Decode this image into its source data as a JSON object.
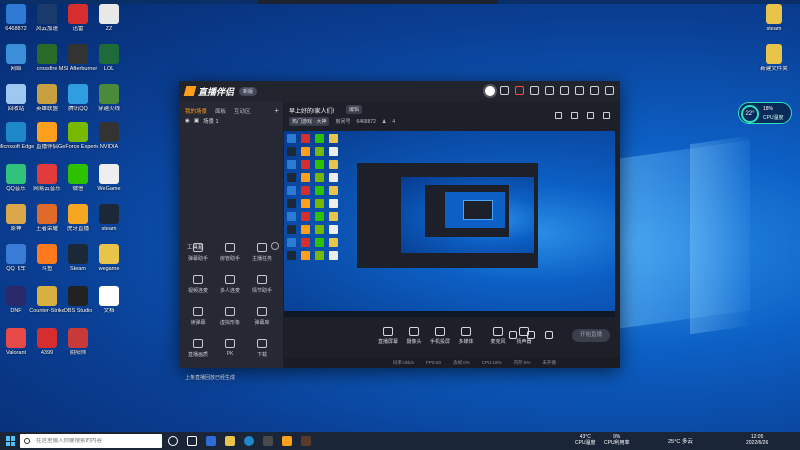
{
  "desktop": {
    "left_icons": [
      {
        "label": "6468872",
        "color": "#2e7bd6"
      },
      {
        "label": "风云加速",
        "color": "#1a3a6b"
      },
      {
        "label": "迅雷",
        "color": "#d62e2e"
      },
      {
        "label": "ZZ",
        "color": "#e8e8e8"
      },
      {
        "label": "网络",
        "color": "#3a8fd8"
      },
      {
        "label": "crossfire",
        "color": "#2a6b2a"
      },
      {
        "label": "MSI Afterburner",
        "color": "#333"
      },
      {
        "label": "LOL",
        "color": "#1e6b3a"
      },
      {
        "label": "回收站",
        "color": "#9ec8f0"
      },
      {
        "label": "英雄联盟",
        "color": "#c8a040"
      },
      {
        "label": "腾讯QQ",
        "color": "#2e9ee0"
      },
      {
        "label": "穿越火线",
        "color": "#4a8a3a"
      },
      {
        "label": "Microsoft Edge",
        "color": "#1e88c8"
      },
      {
        "label": "直播伴侣",
        "color": "#ff9f1c"
      },
      {
        "label": "GeForce Experience",
        "color": "#76b900"
      },
      {
        "label": "NVIDIA",
        "color": "#333"
      },
      {
        "label": "QQ音乐",
        "color": "#31c27c"
      },
      {
        "label": "网易云音乐",
        "color": "#e23b3b"
      },
      {
        "label": "微信",
        "color": "#2dc100"
      },
      {
        "label": "WeGame",
        "color": "#eee"
      },
      {
        "label": "原神",
        "color": "#d9a64a"
      },
      {
        "label": "王者荣耀",
        "color": "#e06a2a"
      },
      {
        "label": "虎牙直播",
        "color": "#f5a623"
      },
      {
        "label": "steam",
        "color": "#1b2838"
      },
      {
        "label": "QQ飞车",
        "color": "#3a7bd5"
      },
      {
        "label": "斗鱼",
        "color": "#ff7a1c"
      },
      {
        "label": "Steam",
        "color": "#1b2838"
      },
      {
        "label": "wegame",
        "color": "#e8c44a"
      },
      {
        "label": "DNF",
        "color": "#2a2a6b"
      },
      {
        "label": "Counter-Strike",
        "color": "#d8b040"
      },
      {
        "label": "OBS Studio",
        "color": "#222"
      },
      {
        "label": "文档",
        "color": "#ffffff"
      },
      {
        "label": "Valorant",
        "color": "#e84a4a"
      },
      {
        "label": "4399",
        "color": "#d62e2e"
      },
      {
        "label": "阴阳师",
        "color": "#c83a3a"
      }
    ],
    "right_icons": [
      {
        "label": "steam",
        "color": "#e8c44a"
      },
      {
        "label": "新建文件夹",
        "color": "#e8c44a"
      }
    ],
    "cpu_widget": {
      "temp": "22°",
      "usage": "18%",
      "label": "CPU温度"
    }
  },
  "app": {
    "title": "直播伴侣",
    "version_badge": "新版",
    "tabs": [
      "我的场景",
      "面板",
      "互动区"
    ],
    "scene_name": "场景 1",
    "room_title": "早上好的!家人们!",
    "edit_label": "编辑",
    "category": "热门游戏 · 大神",
    "room_id_label": "房间号",
    "room_id": "6468872",
    "fans_count": "4",
    "tools_header": "工具箱",
    "tools": [
      {
        "label": "弹幕助手"
      },
      {
        "label": "房管助手"
      },
      {
        "label": "主播任务"
      },
      {
        "label": "视频连麦"
      },
      {
        "label": "多人连麦"
      },
      {
        "label": "情节助手"
      },
      {
        "label": "读弹幕"
      },
      {
        "label": "虚拟形象"
      },
      {
        "label": "弹幕库"
      },
      {
        "label": "直播画质"
      },
      {
        "label": "PK"
      },
      {
        "label": "下载"
      }
    ],
    "notice": "上条直播回放已经生成",
    "controls": [
      {
        "label": "直播屏幕"
      },
      {
        "label": "摄像头"
      },
      {
        "label": "手机投屏"
      },
      {
        "label": "多媒体"
      },
      {
        "label": "麦克风"
      },
      {
        "label": "扬声器"
      }
    ],
    "start_button": "开始直播",
    "status": [
      "码率:0kb/s",
      "FPS:60",
      "丢帧:0%",
      "CPU:18%",
      "内存:5%",
      "未开播"
    ]
  },
  "taskbar": {
    "search_placeholder": "在这里输入你要搜索的内容",
    "cpu_temp": "43°C",
    "cpu_temp_label": "CPU温度",
    "cpu_usage": "9%",
    "cpu_usage_label": "CPU利用率",
    "weather": "25°C 多云",
    "time": "12:05",
    "date": "2022/6/26"
  }
}
